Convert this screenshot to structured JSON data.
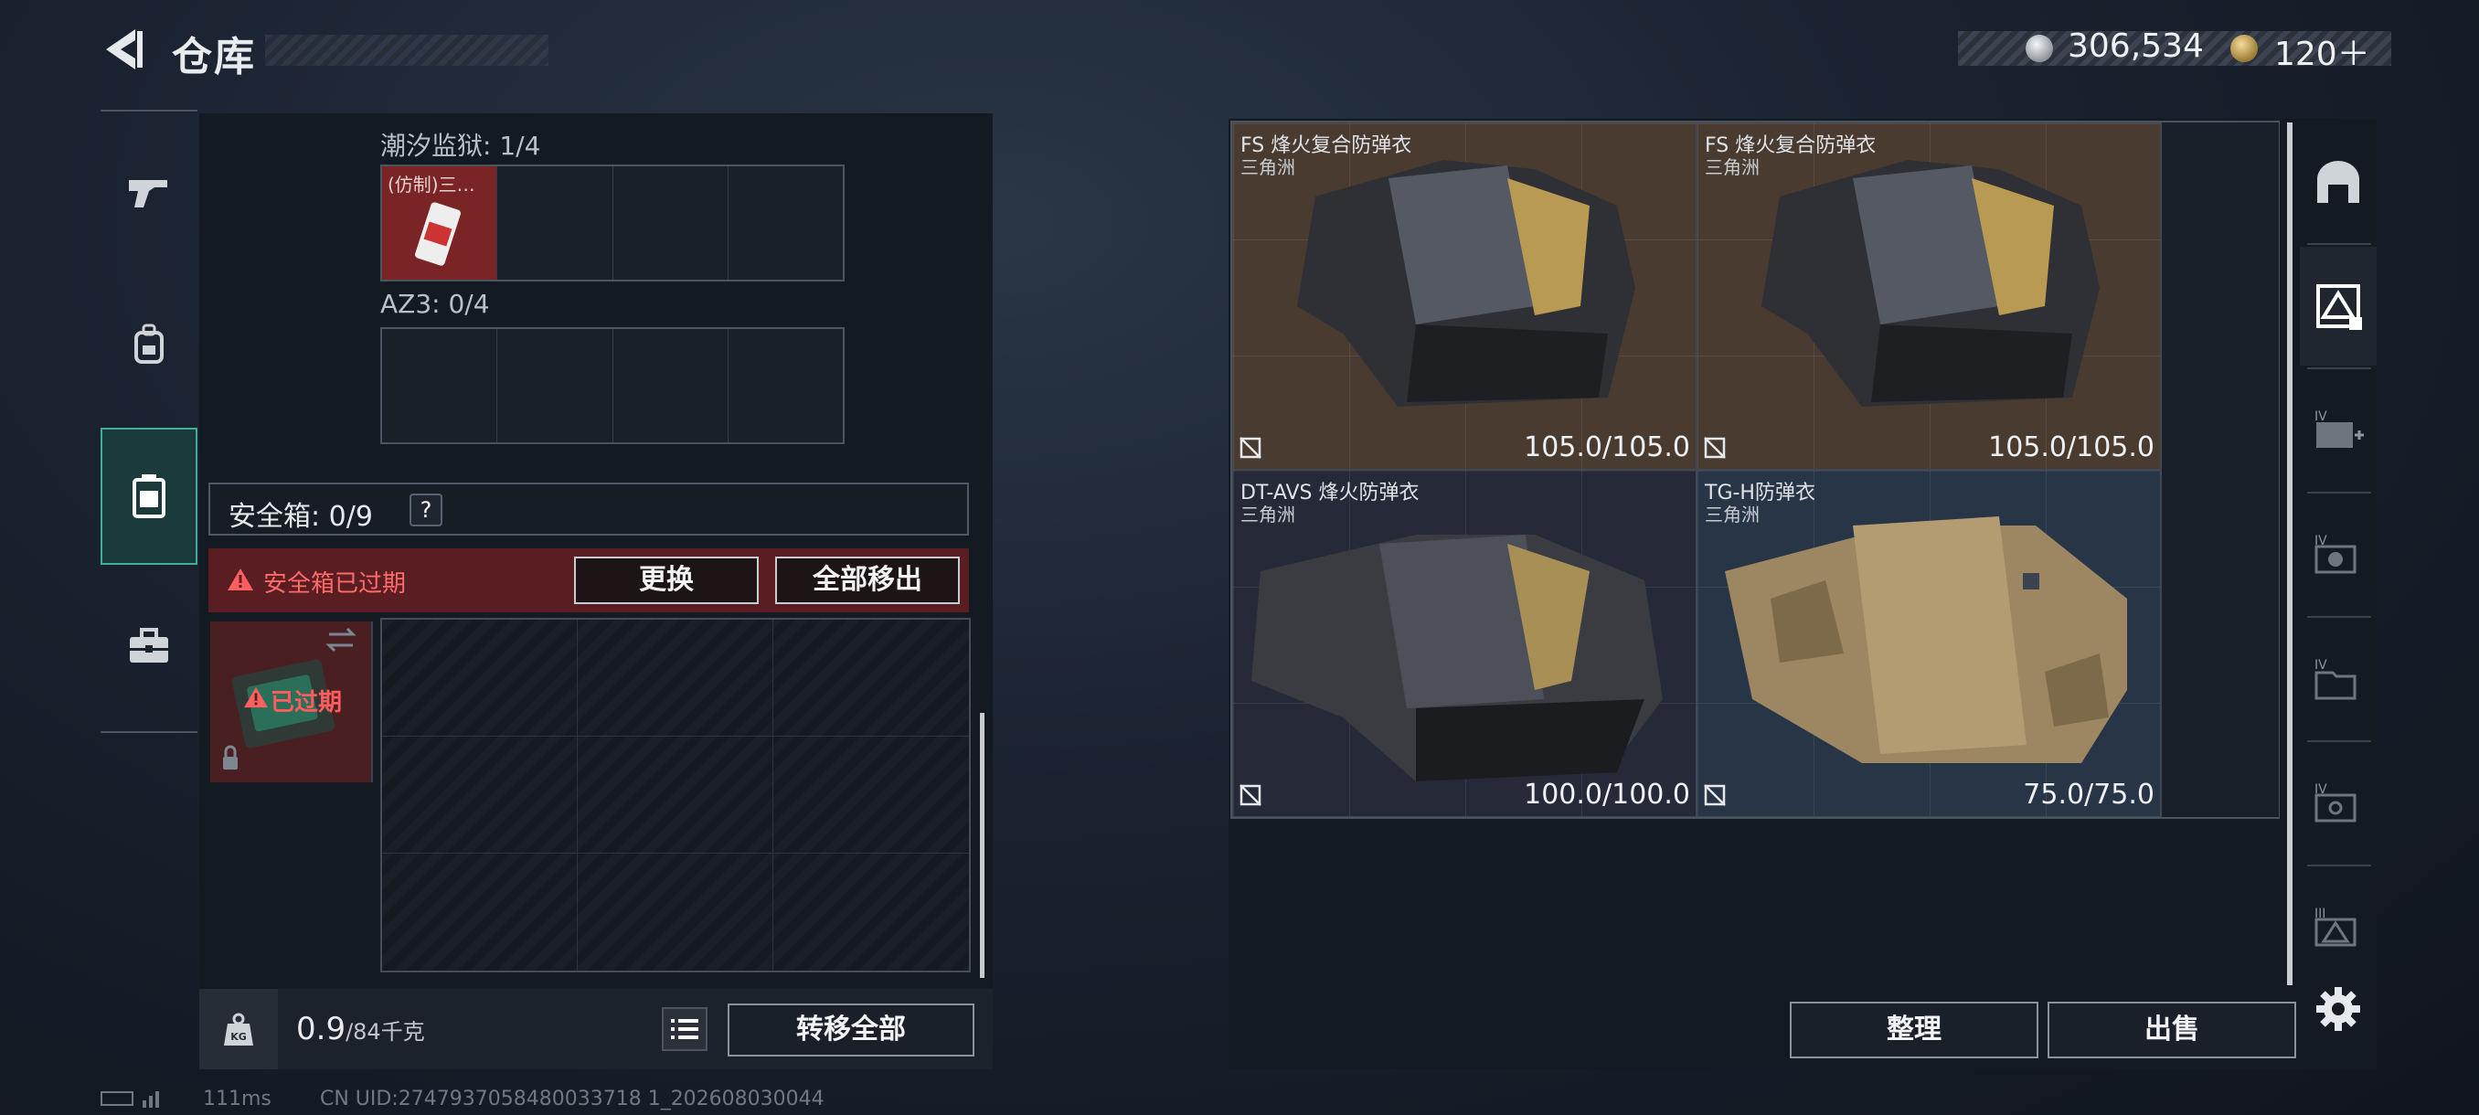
{
  "header": {
    "title": "仓库"
  },
  "currency": {
    "silver": "306,534",
    "gold": "120＋"
  },
  "nav": {
    "items": [
      {
        "name": "weapons",
        "icon": "gun-icon"
      },
      {
        "name": "equipment",
        "icon": "backpack-icon"
      },
      {
        "name": "safebox",
        "icon": "safebox-icon",
        "active": true
      },
      {
        "name": "toolbox",
        "icon": "briefcase-icon"
      }
    ]
  },
  "left": {
    "tidal_label": "潮汐监狱: 1/4",
    "tidal_item_label": "(仿制)三…",
    "az3_label": "AZ3: 0/4",
    "safebox_title": "安全箱: 0/9",
    "help": "?",
    "expired_text": "安全箱已过期",
    "replace_btn": "更换",
    "move_all_btn": "全部移出",
    "safebox_card_label": "已过期",
    "weight_value": "0.9",
    "weight_unit": "/84千克",
    "transfer_btn": "转移全部"
  },
  "items": [
    {
      "name": "FS 烽火复合防弹衣",
      "sub": "三角洲",
      "durability": "105.0/105.0"
    },
    {
      "name": "FS 烽火复合防弹衣",
      "sub": "三角洲",
      "durability": "105.0/105.0"
    },
    {
      "name": "DT-AVS 烽火防弹衣",
      "sub": "三角洲",
      "durability": "100.0/100.0"
    },
    {
      "name": "TG-H防弹衣",
      "sub": "三角洲",
      "durability": "75.0/75.0"
    }
  ],
  "right": {
    "tidy_btn": "整理",
    "sell_btn": "出售"
  },
  "footer": {
    "ping": "111ms",
    "uid": "CN UID:2747937058480033718 1_202608030044"
  },
  "colors": {
    "accent": "#3fae9a",
    "expired": "#ff6b6b",
    "item_gold_bg": "#4a3b30",
    "item_blue_bg": "#283546"
  }
}
